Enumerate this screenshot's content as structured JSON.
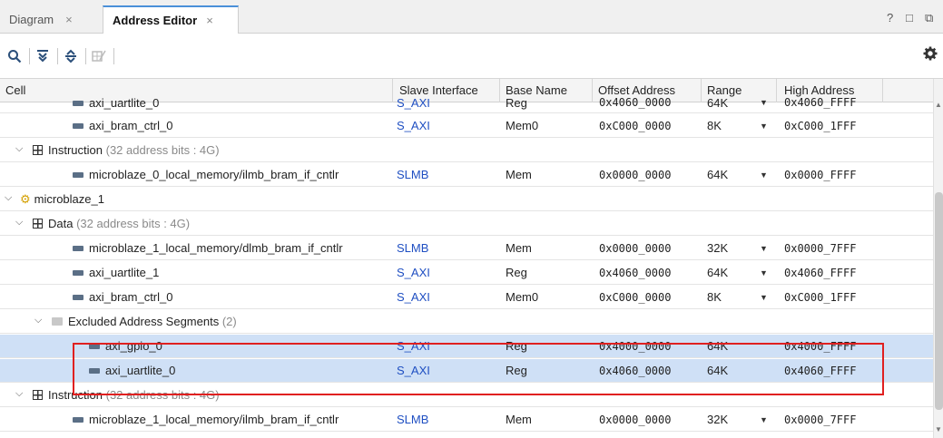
{
  "tabs": [
    {
      "label": "Diagram",
      "close": "×"
    },
    {
      "label": "Address Editor",
      "close": "×"
    }
  ],
  "window_controls": {
    "help": "?",
    "restore": "□",
    "float": "⧉"
  },
  "toolbar": {
    "icons": [
      "search-icon",
      "collapse-all-icon",
      "expand-all-icon",
      "assign-address-icon"
    ],
    "settings_icon": "gear-icon"
  },
  "columns": [
    "Cell",
    "Slave Interface",
    "Base Name",
    "Offset Address",
    "Range",
    "High Address"
  ],
  "rows": [
    {
      "kind": "segment",
      "name": "axi_uartlite_0",
      "slave": "S_AXI",
      "base": "Reg",
      "offset": "0x4060_0000",
      "range": "64K",
      "dropdown": true,
      "high": "0x4060_FFFF"
    },
    {
      "kind": "segment",
      "name": "axi_bram_ctrl_0",
      "slave": "S_AXI",
      "base": "Mem0",
      "offset": "0xC000_0000",
      "range": "8K",
      "dropdown": true,
      "high": "0xC000_1FFF"
    },
    {
      "kind": "space",
      "name": "Instruction",
      "detail": "(32 address bits : 4G)"
    },
    {
      "kind": "segment",
      "name": "microblaze_0_local_memory/ilmb_bram_if_cntlr",
      "slave": "SLMB",
      "base": "Mem",
      "offset": "0x0000_0000",
      "range": "64K",
      "dropdown": true,
      "high": "0x0000_FFFF"
    },
    {
      "kind": "processor",
      "name": "microblaze_1"
    },
    {
      "kind": "space",
      "name": "Data",
      "detail": "(32 address bits : 4G)"
    },
    {
      "kind": "segment",
      "name": "microblaze_1_local_memory/dlmb_bram_if_cntlr",
      "slave": "SLMB",
      "base": "Mem",
      "offset": "0x0000_0000",
      "range": "32K",
      "dropdown": true,
      "high": "0x0000_7FFF"
    },
    {
      "kind": "segment",
      "name": "axi_uartlite_1",
      "slave": "S_AXI",
      "base": "Reg",
      "offset": "0x4060_0000",
      "range": "64K",
      "dropdown": true,
      "high": "0x4060_FFFF"
    },
    {
      "kind": "segment",
      "name": "axi_bram_ctrl_0",
      "slave": "S_AXI",
      "base": "Mem0",
      "offset": "0xC000_0000",
      "range": "8K",
      "dropdown": true,
      "high": "0xC000_1FFF"
    },
    {
      "kind": "excluded",
      "name": "Excluded Address Segments",
      "detail": "(2)"
    },
    {
      "kind": "segment",
      "name": "axi_gpio_0",
      "slave": "S_AXI",
      "base": "Reg",
      "offset": "0x4000_0000",
      "range": "64K",
      "dropdown": false,
      "high": "0x4000_FFFF",
      "selected": true
    },
    {
      "kind": "segment",
      "name": "axi_uartlite_0",
      "slave": "S_AXI",
      "base": "Reg",
      "offset": "0x4060_0000",
      "range": "64K",
      "dropdown": false,
      "high": "0x4060_FFFF",
      "selected": true
    },
    {
      "kind": "space",
      "name": "Instruction",
      "detail": "(32 address bits : 4G)"
    },
    {
      "kind": "segment",
      "name": "microblaze_1_local_memory/ilmb_bram_if_cntlr",
      "slave": "SLMB",
      "base": "Mem",
      "offset": "0x0000_0000",
      "range": "32K",
      "dropdown": true,
      "high": "0x0000_7FFF"
    }
  ]
}
